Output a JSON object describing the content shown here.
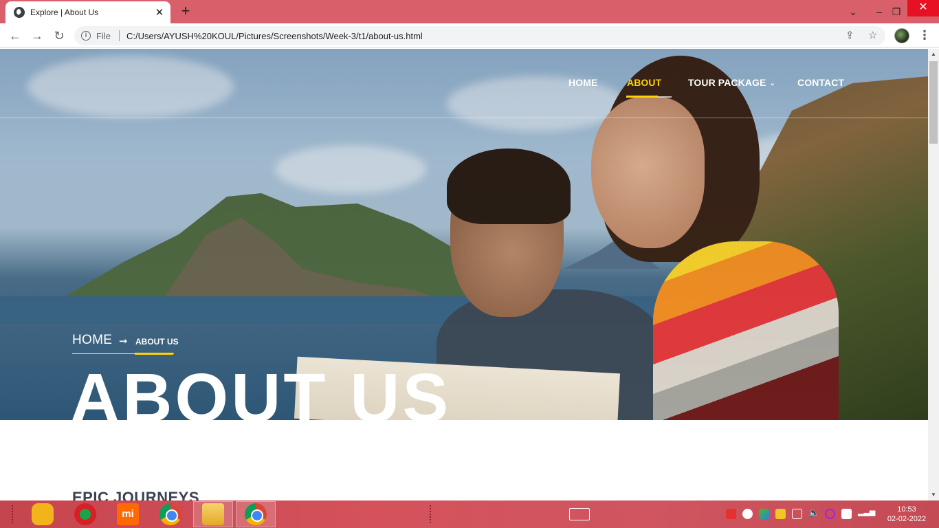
{
  "browser": {
    "tab_title": "Explore | About Us",
    "tab_close": "✕",
    "new_tab": "+",
    "file_label": "File",
    "url": "C:/Users/AYUSH%20KOUL/Pictures/Screenshots/Week-3/t1/about-us.html"
  },
  "site_nav": {
    "items": [
      {
        "label": "HOME",
        "active": false
      },
      {
        "label": "ABOUT",
        "active": true
      },
      {
        "label": "TOUR PACKAGE",
        "active": false,
        "has_dropdown": true
      },
      {
        "label": "CONTACT",
        "active": false
      }
    ],
    "accent_color": "#ffd400"
  },
  "hero": {
    "breadcrumb_home": "HOME",
    "breadcrumb_current": "ABOUT US",
    "title": "ABOUT US"
  },
  "content": {
    "section_heading": "EPIC JOURNEYS"
  },
  "taskbar": {
    "time": "10:53",
    "date": "02-02-2022"
  },
  "colors": {
    "titlebar": "#d9606a",
    "taskbar": "#c5454f",
    "heading": "#3b4350"
  }
}
